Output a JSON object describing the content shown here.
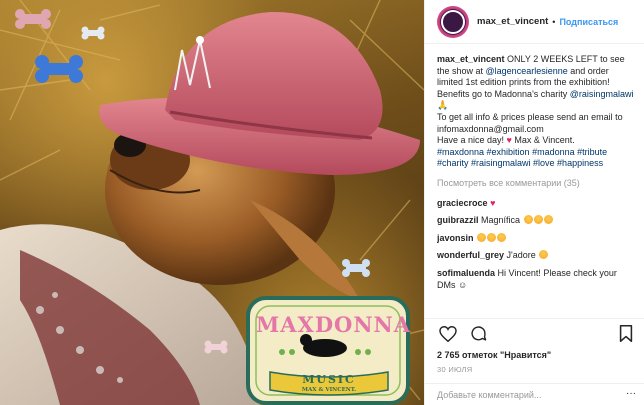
{
  "post": {
    "image_alt": "Golden retriever wearing a pink cowboy hat and sequined jacket lying in straw",
    "logo": {
      "title": "MAXDONNA",
      "subtitle": "MUSIC",
      "byline": "MAX & VINCENT."
    }
  },
  "header": {
    "username": "max_et_vincent",
    "separator": "•",
    "follow_label": "Подписаться"
  },
  "caption": {
    "username": "max_et_vincent",
    "text_1": " ONLY 2 WEEKS LEFT to see the show at ",
    "mention_1": "@lagencearlesienne",
    "text_2": " and order limited 1st edition prints from the exhibition! Benefits go to Madonna's charity ",
    "mention_2": "@raisingmalawi",
    "text_3": " 🙏",
    "text_4": "To get all info & prices please send an email to infomaxdonna@gmail.com",
    "text_5": "Have a nice day! ",
    "heart": "♥",
    "text_6": " Max & Vincent.",
    "hashtags": "#maxdonna #exhibition #madonna #tribute #charity #raisingmalawi #love #happiness"
  },
  "view_all_comments": "Посмотреть все комментарии (35)",
  "comments": [
    {
      "user": "graciecroce",
      "text": "",
      "heart": "♥",
      "emojis": 0
    },
    {
      "user": "guibrazzil",
      "text": "Magnífica",
      "heart": "",
      "emojis": 3
    },
    {
      "user": "javonsin",
      "text": "",
      "heart": "",
      "emojis": 3
    },
    {
      "user": "wonderful_grey",
      "text": "J'adore",
      "heart": "",
      "emojis": 1
    },
    {
      "user": "sofimaluenda",
      "text": "Hi Vincent! Please check your DMs ☺",
      "heart": "",
      "emojis": 0
    }
  ],
  "actions": {
    "icons": [
      "heart-icon",
      "comment-icon",
      "bookmark-icon"
    ]
  },
  "likes": "2 765 отметок \"Нравится\"",
  "date": "30 ИЮЛЯ",
  "add_comment_placeholder": "Добавьте комментарий...",
  "more_label": "···",
  "colors": {
    "link": "#003569",
    "follow": "#3897f0",
    "hat": "#c65a6a",
    "badge_border": "#2a6c5a",
    "badge_bg": "#f3ecc6"
  }
}
